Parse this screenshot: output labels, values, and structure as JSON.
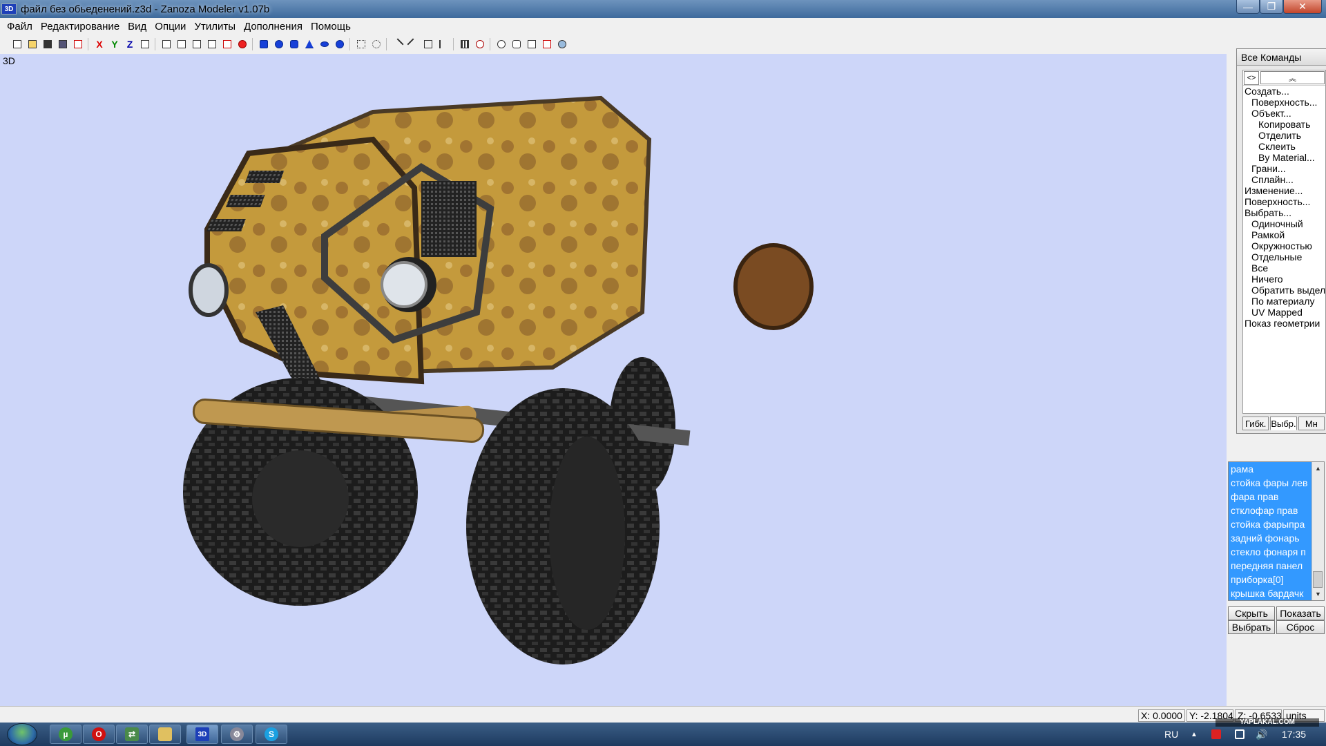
{
  "window": {
    "title": "файл без обьеденений.z3d - Zanoza Modeler v1.07b",
    "app_icon_text": "3D",
    "controls": [
      "—",
      "❐",
      "✕"
    ]
  },
  "menu": [
    "Файл",
    "Редактирование",
    "Вид",
    "Опции",
    "Утилиты",
    "Дополнения",
    "Помощь"
  ],
  "toolbar": {
    "axis_labels": [
      "X",
      "Y",
      "Z"
    ]
  },
  "viewport": {
    "label": "3D",
    "background": "#cdd6f9"
  },
  "commands_panel": {
    "title": "Все Команды",
    "toggle_label": "<>",
    "collapse_label": "︽",
    "tree": [
      {
        "level": 0,
        "text": "Создать..."
      },
      {
        "level": 1,
        "text": "Поверхность..."
      },
      {
        "level": 1,
        "text": "Объект..."
      },
      {
        "level": 2,
        "text": "Копировать"
      },
      {
        "level": 2,
        "text": "Отделить"
      },
      {
        "level": 2,
        "text": "Склеить"
      },
      {
        "level": 2,
        "text": "By Material..."
      },
      {
        "level": 1,
        "text": "Грани..."
      },
      {
        "level": 1,
        "text": "Сплайн..."
      },
      {
        "level": 0,
        "text": "Изменение..."
      },
      {
        "level": 0,
        "text": "Поверхность..."
      },
      {
        "level": 0,
        "text": "Выбрать..."
      },
      {
        "level": 1,
        "text": "Одиночный"
      },
      {
        "level": 1,
        "text": "Рамкой"
      },
      {
        "level": 1,
        "text": "Окружностью"
      },
      {
        "level": 1,
        "text": "Отдельные"
      },
      {
        "level": 1,
        "text": "Все"
      },
      {
        "level": 1,
        "text": "Ничего"
      },
      {
        "level": 1,
        "text": "Обратить выдел"
      },
      {
        "level": 1,
        "text": "По материалу"
      },
      {
        "level": 1,
        "text": "UV Mapped"
      },
      {
        "level": 0,
        "text": "Показ геометрии"
      }
    ],
    "tabs": [
      "Гибк.",
      "Выбр.",
      "Мн"
    ]
  },
  "object_list": {
    "items": [
      "рама",
      "стойка фары лев",
      "фара прав",
      "стклофар прав",
      "стойка фарыпра",
      "задний фонарь",
      "стекло фонаря п",
      "передняя панел",
      "приборка[0]",
      "крышка бардачк"
    ],
    "scroll_up": "▲",
    "scroll_down": "▼",
    "buttons": {
      "hide": "Скрыть",
      "show": "Показать",
      "select": "Выбрать",
      "reset": "Сброс"
    }
  },
  "status": {
    "x": "X: 0.0000",
    "y": "Y: -2.1804",
    "z": "Z: -0.6533",
    "units": "units"
  },
  "taskbar": {
    "language": "RU",
    "time": "17:35",
    "watermark": "YAPLAKAL.COM",
    "tray_arrow": "▲",
    "sound_icon": "🔊"
  },
  "colors": {
    "selection": "#3399ff",
    "body_paint": "#c49a3c"
  }
}
